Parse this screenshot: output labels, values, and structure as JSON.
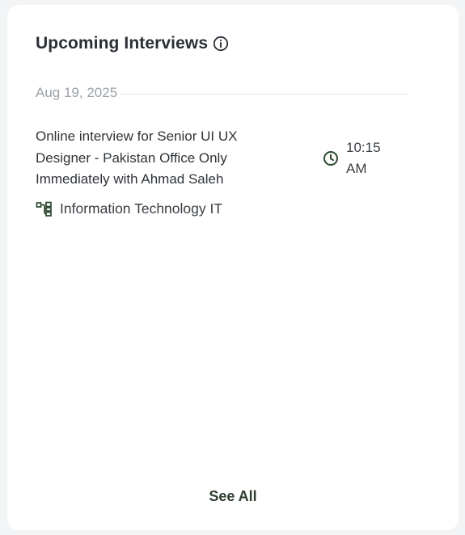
{
  "widget": {
    "title": "Upcoming Interviews",
    "info_icon": "info-circle-icon",
    "accent_color": "#2e4a30"
  },
  "date_group": {
    "date": "Aug 19, 2025"
  },
  "interviews": [
    {
      "title": "Online interview for Senior UI UX Designer - Pakistan Office Only Immediately with Ahmad Saleh",
      "time": "10:15 AM",
      "time_icon": "clock-icon",
      "department": "Information Technology IT",
      "department_icon": "org-chart-icon"
    }
  ],
  "footer": {
    "see_all_label": "See All"
  }
}
